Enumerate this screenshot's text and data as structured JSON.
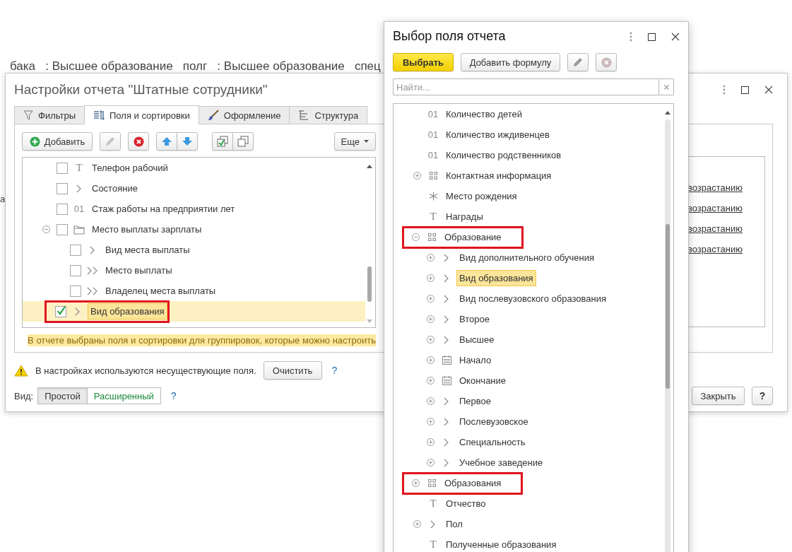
{
  "background_text": "бака   : Высшее образование   полг   : Высшее образование   спец",
  "background_fragment": "а",
  "settings_window": {
    "title": "Настройки отчета \"Штатные сотрудники\"",
    "tabs": [
      {
        "label": "Фильтры",
        "kind": "filter",
        "selected": false
      },
      {
        "label": "Поля и сортировки",
        "kind": "sort",
        "selected": true
      },
      {
        "label": "Оформление",
        "kind": "brush",
        "selected": false
      },
      {
        "label": "Структура",
        "kind": "structure",
        "selected": false
      }
    ],
    "toolbar": {
      "add": "Добавить",
      "more": "Еще"
    },
    "fields": [
      {
        "label": "Телефон рабочий",
        "kind": "text",
        "glyph": "T",
        "checked": false,
        "selected": false
      },
      {
        "label": "Состояние",
        "kind": "ref",
        "checked": false,
        "selected": false
      },
      {
        "label": "Стаж работы на предприятии лет",
        "kind": "number",
        "glyph": "01",
        "checked": false,
        "selected": false
      },
      {
        "label": "Место выплаты зарплаты",
        "kind": "folder",
        "checked": false,
        "selected": false,
        "expanded": true,
        "children": [
          {
            "label": "Вид места выплаты",
            "kind": "ref",
            "checked": false,
            "selected": false
          },
          {
            "label": "Место выплаты",
            "kind": "ref_multi",
            "checked": false,
            "selected": false
          },
          {
            "label": "Владелец места выплаты",
            "kind": "ref_multi",
            "checked": false,
            "selected": false
          }
        ]
      },
      {
        "label": "Вид образования",
        "kind": "ref",
        "checked": true,
        "selected": true,
        "outlined": true
      }
    ],
    "info_message": "В отчете выбраны поля и сортировки для группировок, которые можно настроить",
    "sort_links": [
      "возрастанию",
      "возрастанию",
      "возрастанию",
      "возрастанию"
    ],
    "warning": {
      "text": "В настройках используются несуществующие поля.",
      "button": "Очистить",
      "help": "?"
    },
    "view": {
      "label": "Вид:",
      "options": [
        {
          "label": "Простой",
          "selected": true
        },
        {
          "label": "Расширенный",
          "selected": false
        }
      ],
      "help": "?"
    },
    "buttons": {
      "close": "Закрыть",
      "help": "?"
    }
  },
  "field_dialog": {
    "title": "Выбор поля отчета",
    "buttons": {
      "choose": "Выбрать",
      "add_formula": "Добавить формулу"
    },
    "search": {
      "placeholder": "Найти..."
    },
    "items": [
      {
        "label": "Количество детей",
        "kind": "number",
        "glyph": "01",
        "selected": false
      },
      {
        "label": "Количество иждивенцев",
        "kind": "number",
        "glyph": "01",
        "selected": false
      },
      {
        "label": "Количество родственников",
        "kind": "number",
        "glyph": "01",
        "selected": false
      },
      {
        "label": "Контактная информация",
        "kind": "group",
        "expanded": false,
        "selected": false
      },
      {
        "label": "Место рождения",
        "kind": "star",
        "selected": false
      },
      {
        "label": "Награды",
        "kind": "text",
        "glyph": "T",
        "selected": false
      },
      {
        "label": "Образование",
        "kind": "group",
        "expanded": true,
        "selected": false,
        "outlined": true,
        "children": [
          {
            "label": "Вид дополнительного обучения",
            "kind": "ref",
            "expanded": false,
            "selected": false
          },
          {
            "label": "Вид образования",
            "kind": "ref",
            "expanded": false,
            "selected": true
          },
          {
            "label": "Вид послевузовского образования",
            "kind": "ref",
            "expanded": false,
            "selected": false
          },
          {
            "label": "Второе",
            "kind": "ref",
            "expanded": false,
            "selected": false
          },
          {
            "label": "Высшее",
            "kind": "ref",
            "expanded": false,
            "selected": false
          },
          {
            "label": "Начало",
            "kind": "date",
            "expanded": false,
            "selected": false
          },
          {
            "label": "Окончание",
            "kind": "date",
            "expanded": false,
            "selected": false
          },
          {
            "label": "Первое",
            "kind": "ref",
            "expanded": false,
            "selected": false
          },
          {
            "label": "Послевузовское",
            "kind": "ref",
            "expanded": false,
            "selected": false
          },
          {
            "label": "Специальность",
            "kind": "ref",
            "expanded": false,
            "selected": false
          },
          {
            "label": "Учебное заведение",
            "kind": "ref",
            "expanded": false,
            "selected": false
          }
        ]
      },
      {
        "label": "Образования",
        "kind": "group",
        "expanded": false,
        "selected": false,
        "outlined": true
      },
      {
        "label": "Отчество",
        "kind": "text",
        "glyph": "T",
        "selected": false
      },
      {
        "label": "Пол",
        "kind": "ref",
        "expanded": false,
        "selected": false
      },
      {
        "label": "Полученные образования",
        "kind": "text",
        "glyph": "T",
        "selected": false
      }
    ]
  }
}
